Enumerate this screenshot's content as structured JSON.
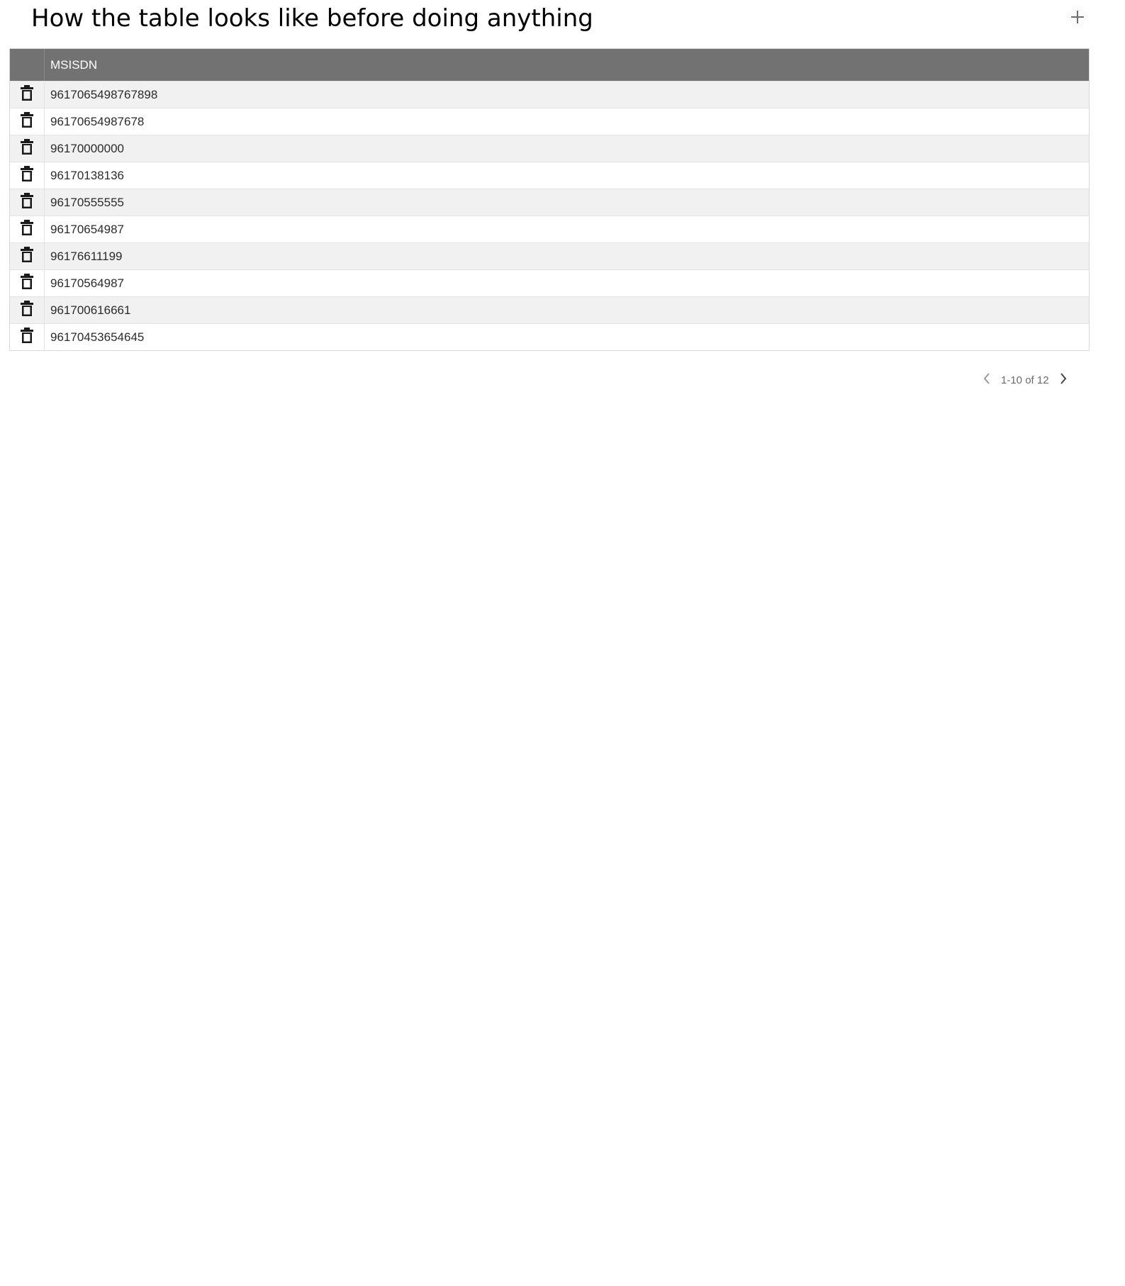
{
  "page": {
    "title": "How the table looks like before doing anything"
  },
  "toolbar": {
    "add_icon": "plus-icon"
  },
  "grid": {
    "column_header": "MSISDN",
    "row_action_icon": "trash-icon",
    "rows": [
      "9617065498767898",
      "96170654987678",
      "96170000000",
      "96170138136",
      "96170555555",
      "96170654987",
      "96176611199",
      "96170564987",
      "961700616661",
      "96170453654645"
    ]
  },
  "pager": {
    "summary": "1-10 of 12",
    "prev_icon": "chevron-left-icon",
    "next_icon": "chevron-right-icon"
  },
  "colors": {
    "header_bg": "#727272",
    "alt_row_bg": "#f1f1f1"
  }
}
